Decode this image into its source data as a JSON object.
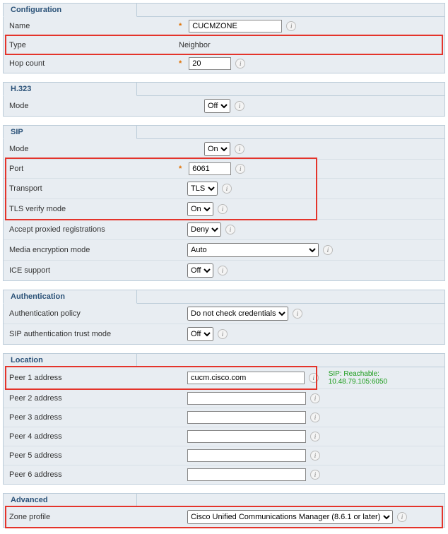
{
  "configuration": {
    "title": "Configuration",
    "name_label": "Name",
    "name_value": "CUCMZONE",
    "type_label": "Type",
    "type_value": "Neighbor",
    "hop_label": "Hop count",
    "hop_value": "20"
  },
  "h323": {
    "title": "H.323",
    "mode_label": "Mode",
    "mode_value": "Off"
  },
  "sip": {
    "title": "SIP",
    "mode_label": "Mode",
    "mode_value": "On",
    "port_label": "Port",
    "port_value": "6061",
    "transport_label": "Transport",
    "transport_value": "TLS",
    "tls_label": "TLS verify mode",
    "tls_value": "On",
    "accept_label": "Accept proxied registrations",
    "accept_value": "Deny",
    "media_label": "Media encryption mode",
    "media_value": "Auto",
    "ice_label": "ICE support",
    "ice_value": "Off"
  },
  "auth": {
    "title": "Authentication",
    "policy_label": "Authentication policy",
    "policy_value": "Do not check credentials",
    "trust_label": "SIP authentication trust mode",
    "trust_value": "Off"
  },
  "location": {
    "title": "Location",
    "peer1_label": "Peer 1 address",
    "peer1_value": "cucm.cisco.com",
    "peer1_status": "SIP: Reachable: 10.48.79.105:6050",
    "peer2_label": "Peer 2 address",
    "peer2_value": "",
    "peer3_label": "Peer 3 address",
    "peer3_value": "",
    "peer4_label": "Peer 4 address",
    "peer4_value": "",
    "peer5_label": "Peer 5 address",
    "peer5_value": "",
    "peer6_label": "Peer 6 address",
    "peer6_value": ""
  },
  "advanced": {
    "title": "Advanced",
    "profile_label": "Zone profile",
    "profile_value": "Cisco Unified Communications Manager (8.6.1 or later)"
  }
}
